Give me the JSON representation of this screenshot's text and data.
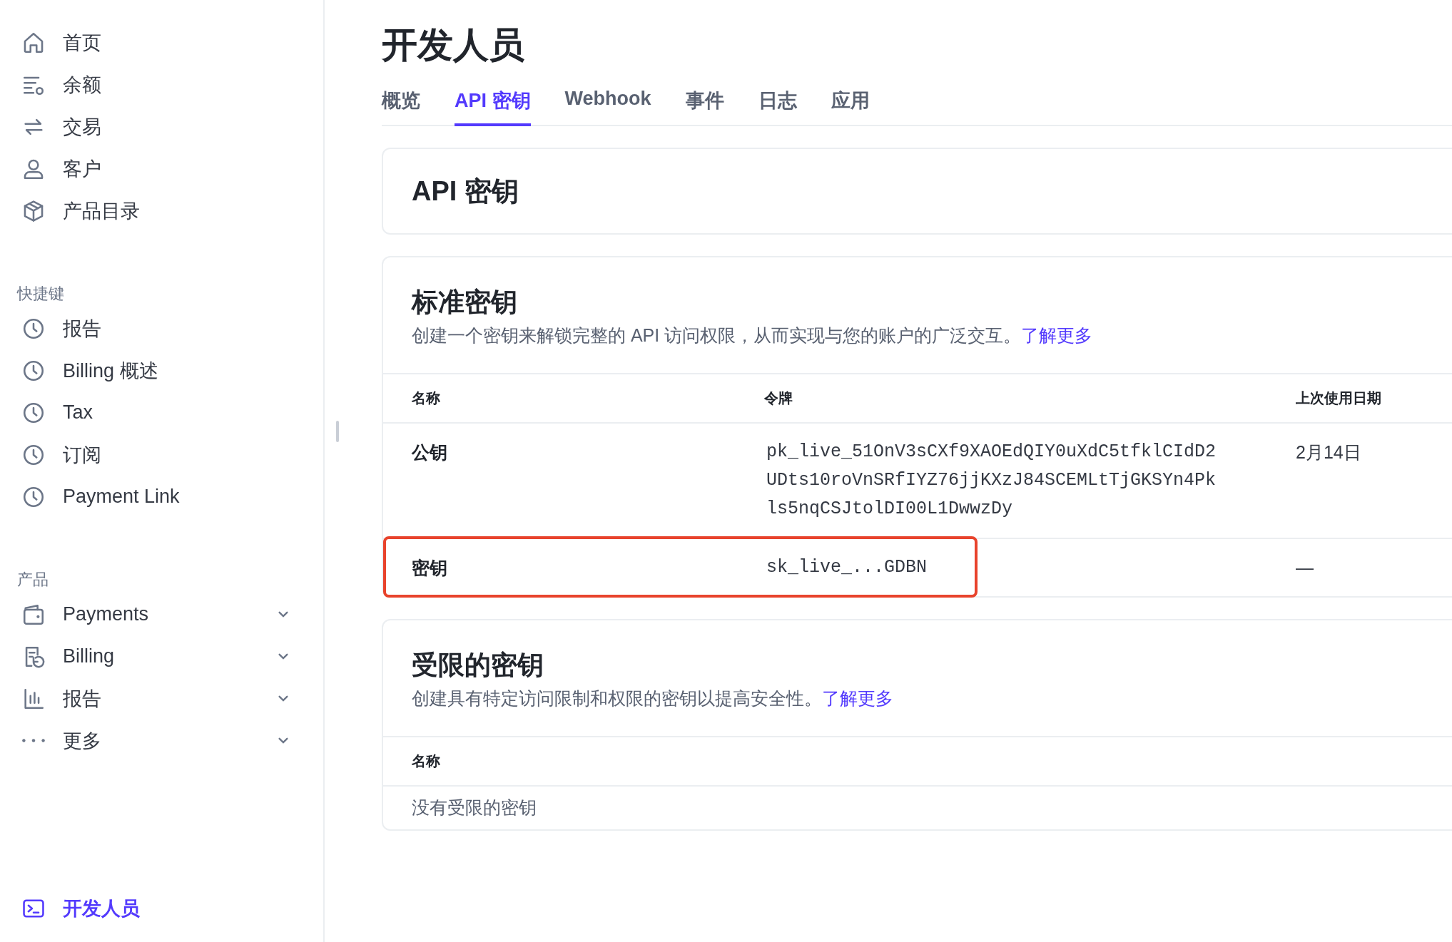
{
  "sidebar": {
    "items": [
      {
        "label": "首页",
        "selected": false
      },
      {
        "label": "余额",
        "selected": false
      },
      {
        "label": "交易",
        "selected": false
      },
      {
        "label": "客户",
        "selected": false
      },
      {
        "label": "产品目录",
        "selected": false
      }
    ],
    "sections": [
      {
        "title": "快捷键",
        "items": [
          {
            "label": "报告",
            "selected": false,
            "kind": "link"
          },
          {
            "label": "Billing 概述",
            "selected": false,
            "kind": "link"
          },
          {
            "label": "Tax",
            "selected": false,
            "kind": "link"
          },
          {
            "label": "订阅",
            "selected": false,
            "kind": "link"
          },
          {
            "label": "Payment Link",
            "selected": false,
            "kind": "link"
          }
        ]
      },
      {
        "title": "产品",
        "items": [
          {
            "label": "Payments",
            "selected": false,
            "kind": "group",
            "expanded": false
          },
          {
            "label": "Billing",
            "selected": false,
            "kind": "group",
            "expanded": false
          },
          {
            "label": "报告",
            "selected": false,
            "kind": "group",
            "expanded": false
          },
          {
            "label": "更多",
            "selected": false,
            "kind": "group",
            "expanded": false
          }
        ]
      }
    ],
    "footer_item": {
      "label": "开发人员",
      "selected": true
    }
  },
  "main": {
    "title": "开发人员",
    "tabs": [
      {
        "label": "概览",
        "selected": false
      },
      {
        "label": "API 密钥",
        "selected": true
      },
      {
        "label": "Webhook",
        "selected": false
      },
      {
        "label": "事件",
        "selected": false
      },
      {
        "label": "日志",
        "selected": false
      },
      {
        "label": "应用",
        "selected": false
      }
    ],
    "header_card": {
      "title": "API 密钥"
    },
    "standard_keys": {
      "title": "标准密钥",
      "description": "创建一个密钥来解锁完整的 API 访问权限，从而实现与您的账户的广泛交互。",
      "link": "了解更多",
      "columns": [
        "名称",
        "令牌",
        "上次使用日期"
      ],
      "rows": [
        {
          "name": "公钥",
          "token": "pk_live_51OnV3sCXf9XAOEdQIY0uXdC5tfklCIdD2UDts10roVnSRfIYZ76jjKXzJ84SCEMLtTjGKSYn4Pkls5nqCSJtolDI00L1DwwzDy",
          "last_used": "2月14日",
          "highlighted": false
        },
        {
          "name": "密钥",
          "token": "sk_live_...GDBN",
          "last_used": "—",
          "highlighted": true
        }
      ]
    },
    "restricted_keys": {
      "title": "受限的密钥",
      "description": "创建具有特定访问限制和权限的密钥以提高安全性。",
      "link": "了解更多",
      "columns": [
        "名称"
      ],
      "empty_text": "没有受限的密钥"
    }
  }
}
